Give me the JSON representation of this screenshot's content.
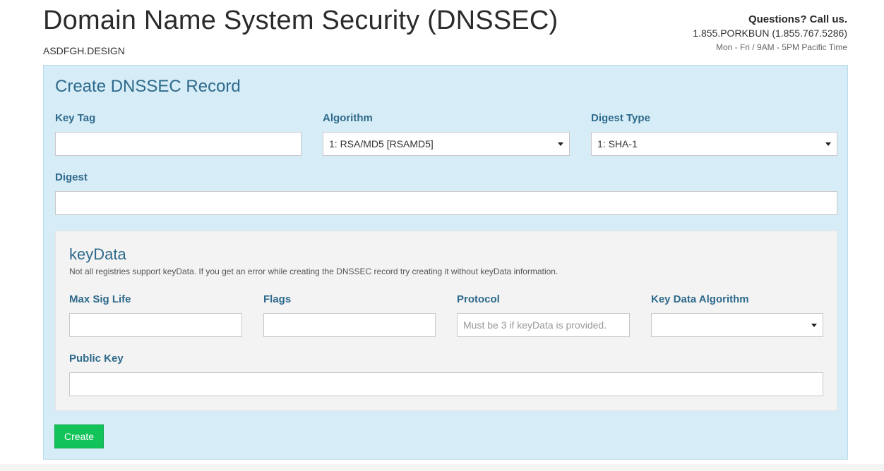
{
  "header": {
    "title": "Domain Name System Security (DNSSEC)",
    "domain": "ASDFGH.DESIGN"
  },
  "contact": {
    "question": "Questions? Call us.",
    "phone": "1.855.PORKBUN (1.855.767.5286)",
    "hours": "Mon - Fri / 9AM - 5PM Pacific Time"
  },
  "form": {
    "title": "Create DNSSEC Record",
    "key_tag": {
      "label": "Key Tag",
      "value": ""
    },
    "algorithm": {
      "label": "Algorithm",
      "selected": "1: RSA/MD5 [RSAMD5]"
    },
    "digest_type": {
      "label": "Digest Type",
      "selected": "1: SHA-1"
    },
    "digest": {
      "label": "Digest",
      "value": ""
    },
    "keydata": {
      "title": "keyData",
      "note": "Not all registries support keyData. If you get an error while creating the DNSSEC record try creating it without keyData information.",
      "max_sig_life": {
        "label": "Max Sig Life",
        "value": ""
      },
      "flags": {
        "label": "Flags",
        "value": ""
      },
      "protocol": {
        "label": "Protocol",
        "placeholder": "Must be 3 if keyData is provided."
      },
      "key_data_algorithm": {
        "label": "Key Data Algorithm",
        "selected": ""
      },
      "public_key": {
        "label": "Public Key",
        "value": ""
      }
    },
    "create_label": "Create"
  },
  "colors": {
    "panel_bg": "#d6ecf6",
    "label_color": "#2e6a8c",
    "button_green": "#12c35a"
  }
}
